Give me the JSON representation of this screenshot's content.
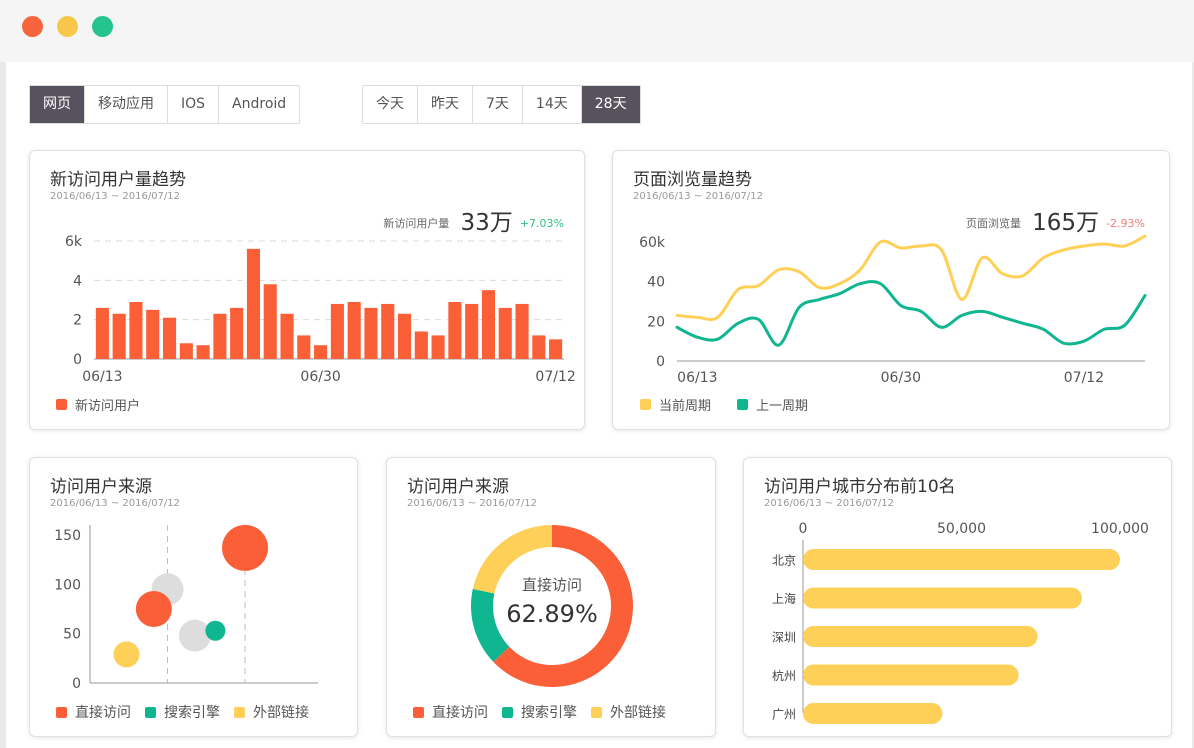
{
  "window": {
    "controls": [
      {
        "name": "close",
        "color": "#f5643b"
      },
      {
        "name": "minimize",
        "color": "#f7c64a"
      },
      {
        "name": "maximize",
        "color": "#25c48f"
      }
    ]
  },
  "colors": {
    "accent_red": "#fa5f38",
    "yellow": "#ffd058",
    "teal": "#0fb68f",
    "gray": "#dddddd",
    "positive": "#2fc082",
    "negative": "#f47a7a",
    "active_segment": "#58525e"
  },
  "platform_tabs": [
    "网页",
    "移动应用",
    "IOS",
    "Android"
  ],
  "platform_active": 0,
  "range_tabs": [
    "今天",
    "昨天",
    "7天",
    "14天",
    "28天"
  ],
  "range_active": 4,
  "cards": {
    "new_users": {
      "title": "新访问用户量趋势",
      "date": "2016/06/13 ~ 2016/07/12",
      "kpi_label": "新访问用户量",
      "kpi_value": "33万",
      "kpi_change": "+7.03%"
    },
    "pageviews": {
      "title": "页面浏览量趋势",
      "date": "2016/06/13 ~ 2016/07/12",
      "kpi_label": "页面浏览量",
      "kpi_value": "165万",
      "kpi_change": "-2.93%"
    },
    "source_scatter": {
      "title": "访问用户来源",
      "date": "2016/06/13 ~ 2016/07/12"
    },
    "source_donut": {
      "title": "访问用户来源",
      "date": "2016/06/13 ~ 2016/07/12",
      "center_label": "直接访问",
      "center_value": "62.89%"
    },
    "cities": {
      "title": "访问用户城市分布前10名",
      "date": "2016/06/13 ~ 2016/07/12"
    }
  },
  "chart_data": [
    {
      "id": "new_users",
      "type": "bar",
      "values": [
        2.6,
        2.3,
        2.9,
        2.5,
        2.1,
        0.8,
        0.7,
        2.3,
        2.6,
        5.6,
        3.8,
        2.3,
        1.2,
        0.7,
        2.8,
        2.9,
        2.6,
        2.8,
        2.3,
        1.4,
        1.2,
        2.9,
        2.8,
        3.5,
        2.6,
        2.8,
        1.2,
        1.0
      ],
      "ylim": [
        0,
        6
      ],
      "yticks": [
        "0",
        "2",
        "4",
        "6k"
      ],
      "xticks": [
        {
          "index": 0,
          "label": "06/13"
        },
        {
          "index": 13,
          "label": "06/30"
        },
        {
          "index": 27,
          "label": "07/12"
        }
      ],
      "grid": true,
      "legend": "bottom-left",
      "series": [
        {
          "name": "新访问用户",
          "color": "#fa5f38"
        }
      ]
    },
    {
      "id": "pageviews",
      "type": "line",
      "ylim": [
        0,
        60
      ],
      "yticks": [
        "0",
        "20",
        "40",
        "60k"
      ],
      "xticks": [
        {
          "index": 1,
          "label": "06/13"
        },
        {
          "index": 11,
          "label": "06/30"
        },
        {
          "index": 20,
          "label": "07/12"
        }
      ],
      "legend": "bottom-left",
      "series": [
        {
          "name": "当前周期",
          "color": "#ffd058",
          "values": [
            23,
            22,
            22,
            36,
            38,
            46,
            45,
            37,
            39,
            46,
            60,
            57,
            58,
            56,
            31,
            52,
            44,
            43,
            52,
            56,
            58,
            59,
            58,
            63
          ]
        },
        {
          "name": "上一周期",
          "color": "#0fb68f",
          "values": [
            17,
            12,
            11,
            19,
            21,
            8,
            27,
            31,
            34,
            39,
            39,
            28,
            25,
            17,
            23,
            25,
            22,
            19,
            16,
            9,
            10,
            16,
            18,
            33
          ]
        }
      ]
    },
    {
      "id": "source_scatter",
      "type": "scatter",
      "ylim": [
        0,
        150
      ],
      "yticks": [
        "0",
        "50",
        "100",
        "150"
      ],
      "legend": "bottom-left",
      "series": [
        {
          "name": "直接访问",
          "color": "#fa5f38",
          "points": [
            {
              "x": 0.28,
              "y": 75,
              "r": 18
            },
            {
              "x": 0.68,
              "y": 137,
              "r": 23
            }
          ]
        },
        {
          "name": "搜索引擎",
          "color": "#0fb68f",
          "points": [
            {
              "x": 0.55,
              "y": 53,
              "r": 10
            }
          ]
        },
        {
          "name": "外部链接",
          "color": "#ffd058",
          "points": [
            {
              "x": 0.16,
              "y": 29,
              "r": 13
            }
          ]
        },
        {
          "name": "",
          "color": "#dddddd",
          "points": [
            {
              "x": 0.34,
              "y": 95,
              "r": 16
            },
            {
              "x": 0.46,
              "y": 48,
              "r": 16
            }
          ]
        }
      ],
      "reference_lines_x": [
        0.34,
        0.68
      ]
    },
    {
      "id": "source_donut",
      "type": "pie",
      "legend": "bottom-center",
      "series": [
        {
          "name": "直接访问",
          "value": 62.89,
          "color": "#fa5f38"
        },
        {
          "name": "搜索引擎",
          "value": 15.5,
          "color": "#0fb68f"
        },
        {
          "name": "外部链接",
          "value": 21.61,
          "color": "#ffd058"
        }
      ]
    },
    {
      "id": "cities",
      "type": "bar",
      "orientation": "horizontal",
      "categories": [
        "北京",
        "上海",
        "深圳",
        "杭州",
        "广州"
      ],
      "values": [
        100000,
        88000,
        74000,
        68000,
        44000
      ],
      "xlim": [
        0,
        100000
      ],
      "xticks": [
        "0",
        "50,000",
        "100,000"
      ],
      "color": "#ffd058"
    }
  ]
}
